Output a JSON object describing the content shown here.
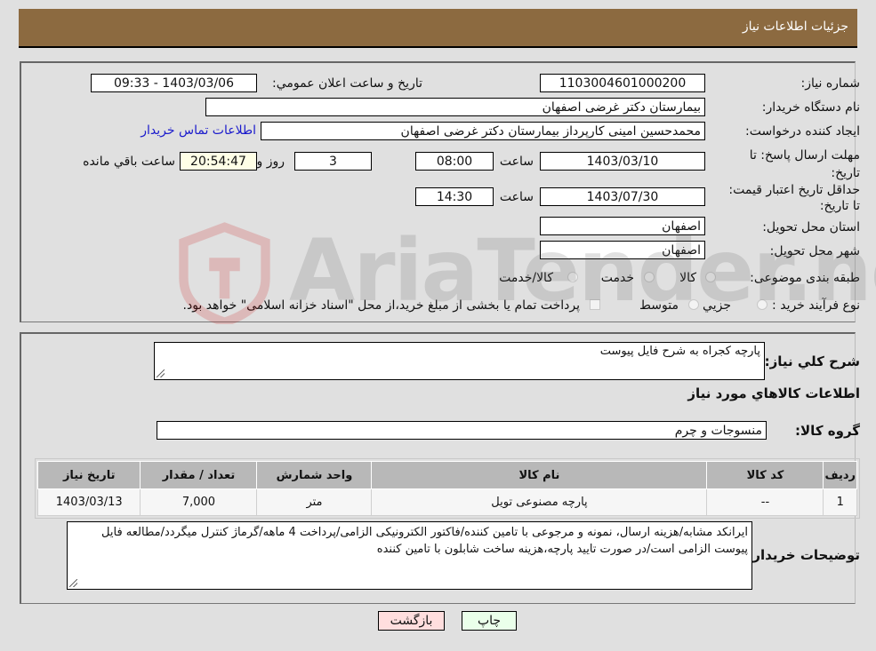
{
  "header": {
    "title": "جزئيات اطلاعات نياز"
  },
  "details": {
    "need_number_label": "شماره نياز:",
    "need_number": "1103004601000200",
    "announce_label": "تاريخ و ساعت اعلان عمومي:",
    "announce_value": "1403/03/06 - 09:33",
    "buyer_org_label": "نام دستگاه خريدار:",
    "buyer_org": "بیمارستان دکتر غرضی اصفهان",
    "creator_label": "ايجاد کننده درخواست:",
    "creator": "محمدحسین امینی کارپرداز بیمارستان دکتر غرضی اصفهان",
    "contact_link": "اطلاعات تماس خريدار",
    "reply_deadline_label": "مهلت ارسال پاسخ: تا تاريخ:",
    "reply_date": "1403/03/10",
    "time_label": "ساعت",
    "reply_time": "08:00",
    "days": "3",
    "days_label": "روز و",
    "remaining_time": "20:54:47",
    "remaining_label": "ساعت باقي مانده",
    "price_validity_label": "حداقل تاريخ اعتبار قيمت: تا تاريخ:",
    "price_validity_date": "1403/07/30",
    "price_validity_time": "14:30",
    "province_label": "استان محل تحويل:",
    "province": "اصفهان",
    "city_label": "شهر محل تحويل:",
    "city": "اصفهان",
    "category_label": "طبقه بندی موضوعی:",
    "category_options": [
      "کالا",
      "خدمت",
      "کالا/خدمت"
    ],
    "process_label": "نوع فرآيند خريد :",
    "process_options": [
      "جزيي",
      "متوسط"
    ],
    "payment_note": "پرداخت تمام يا بخشی از مبلغ خريد،از محل \"اسناد خزانه اسلامی\" خواهد بود."
  },
  "watermark": {
    "text": "AriaTender.neT"
  },
  "needs": {
    "summary_label": "شرح کلي نياز:",
    "summary": "پارچه کجراه به شرح فایل پیوست",
    "goods_info_title": "اطلاعات کالاهاي مورد نياز",
    "goods_group_label": "گروه کالا:",
    "goods_group": "منسوجات و چرم",
    "table": {
      "headers": [
        "رديف",
        "کد کالا",
        "نام کالا",
        "واحد شمارش",
        "تعداد / مقدار",
        "تاريخ نياز"
      ],
      "rows": [
        [
          "1",
          "--",
          "پارچه مصنوعی تویل",
          "متر",
          "7,000",
          "1403/03/13"
        ]
      ]
    },
    "buyer_notes_label": "توضيحات خريدار:",
    "buyer_notes": "ایرانکد مشابه/هزینه ارسال، نمونه و مرجوعی با تامین کننده/فاکتور الکترونیکی الزامی/پرداخت 4 ماهه/گرماژ کنترل میگردد/مطالعه فایل پیوست الزامی است/در صورت تایید پارچه،هزینه ساخت شابلون با تامین کننده"
  },
  "buttons": {
    "print": "چاپ",
    "back": "بازگشت"
  },
  "colors": {
    "header_bg": "#8c6a40",
    "print_bg": "#eaffea",
    "back_bg": "#ffdede",
    "link": "#1a1acc"
  }
}
